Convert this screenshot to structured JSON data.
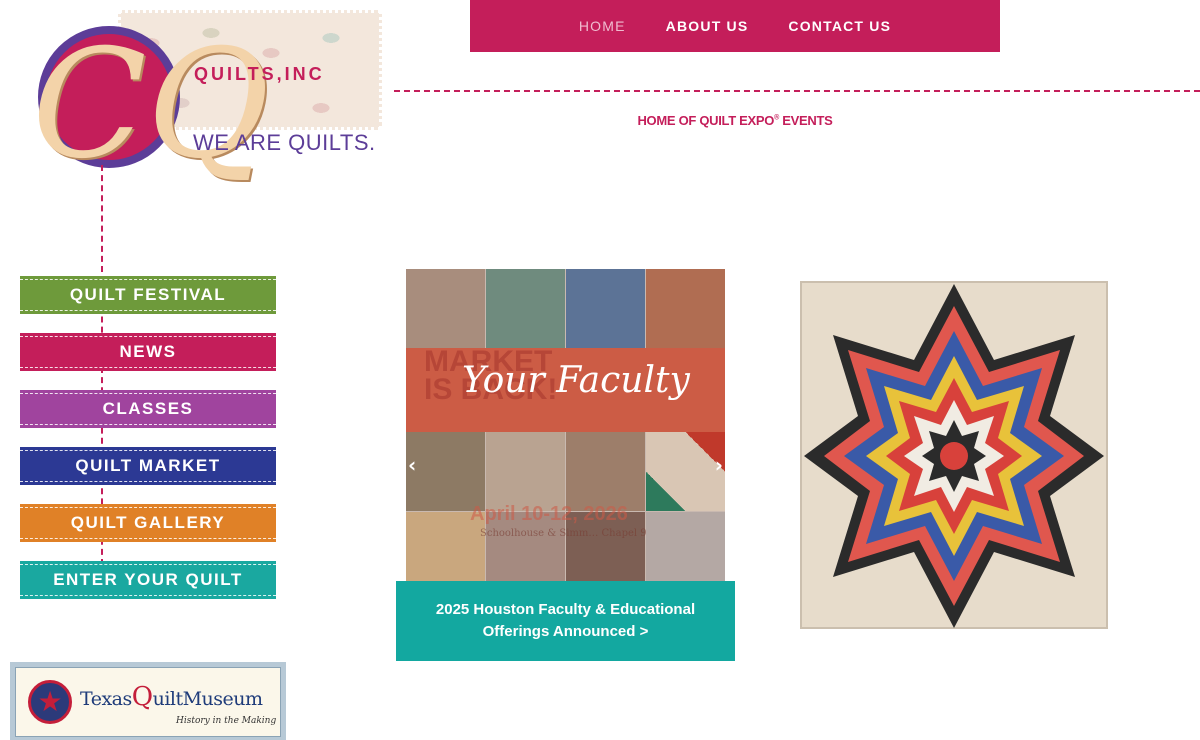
{
  "logo": {
    "name": "QUILTS,INC",
    "tagline": "WE ARE QUILTS."
  },
  "topnav": {
    "items": [
      "HOME",
      "ABOUT US",
      "CONTACT US"
    ]
  },
  "tagline": {
    "text": "HOME OF QUILT EXPO",
    "reg": "®",
    "suffix": " EVENTS"
  },
  "menu": {
    "items": [
      {
        "label": "QUILT FESTIVAL",
        "color": "#6e9a3b"
      },
      {
        "label": "NEWS",
        "color": "#c41e5a"
      },
      {
        "label": "CLASSES",
        "color": "#a0449e"
      },
      {
        "label": "QUILT MARKET",
        "color": "#2c3994"
      },
      {
        "label": "QUILT GALLERY",
        "color": "#e08127"
      },
      {
        "label": "ENTER YOUR QUILT",
        "color": "#1aa8a0"
      }
    ]
  },
  "museum": {
    "title_pre": "Texas",
    "title_q": "Q",
    "title_post": "uiltMuseum",
    "subtitle": "History in the Making"
  },
  "slider": {
    "banner_text": "Your Faculty",
    "ghost_text": "MARKET\nIS BACK!",
    "ghost_date": "April 10-12, 2026",
    "ghost_sub": "Schoolhouse & Simm… Chapel 9",
    "prev_icon": "chevron-left-icon",
    "next_icon": "chevron-right-icon",
    "caption": "2025 Houston Faculty & Educational Offerings Announced >"
  },
  "colors": {
    "brand": "#c41e5a",
    "purple": "#5c3d98",
    "teal": "#13a8a0"
  }
}
